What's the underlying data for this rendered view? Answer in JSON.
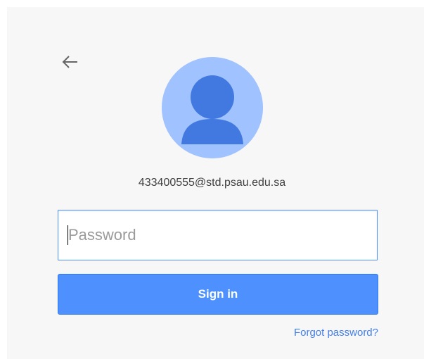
{
  "back": {
    "icon": "arrow-left-icon"
  },
  "avatar": {
    "icon": "default-user-icon"
  },
  "account": {
    "email": "433400555@std.psau.edu.sa"
  },
  "password": {
    "placeholder": "Password",
    "value": ""
  },
  "signin": {
    "label": "Sign in"
  },
  "forgot": {
    "label": "Forgot password?"
  },
  "colors": {
    "card_background": "#f7f7f7",
    "avatar_background": "#a0c3ff",
    "avatar_figure": "#4179e0",
    "button_background": "#4d90fe",
    "button_text": "#ffffff",
    "link": "#427fed",
    "input_border": "#4d90fe"
  }
}
